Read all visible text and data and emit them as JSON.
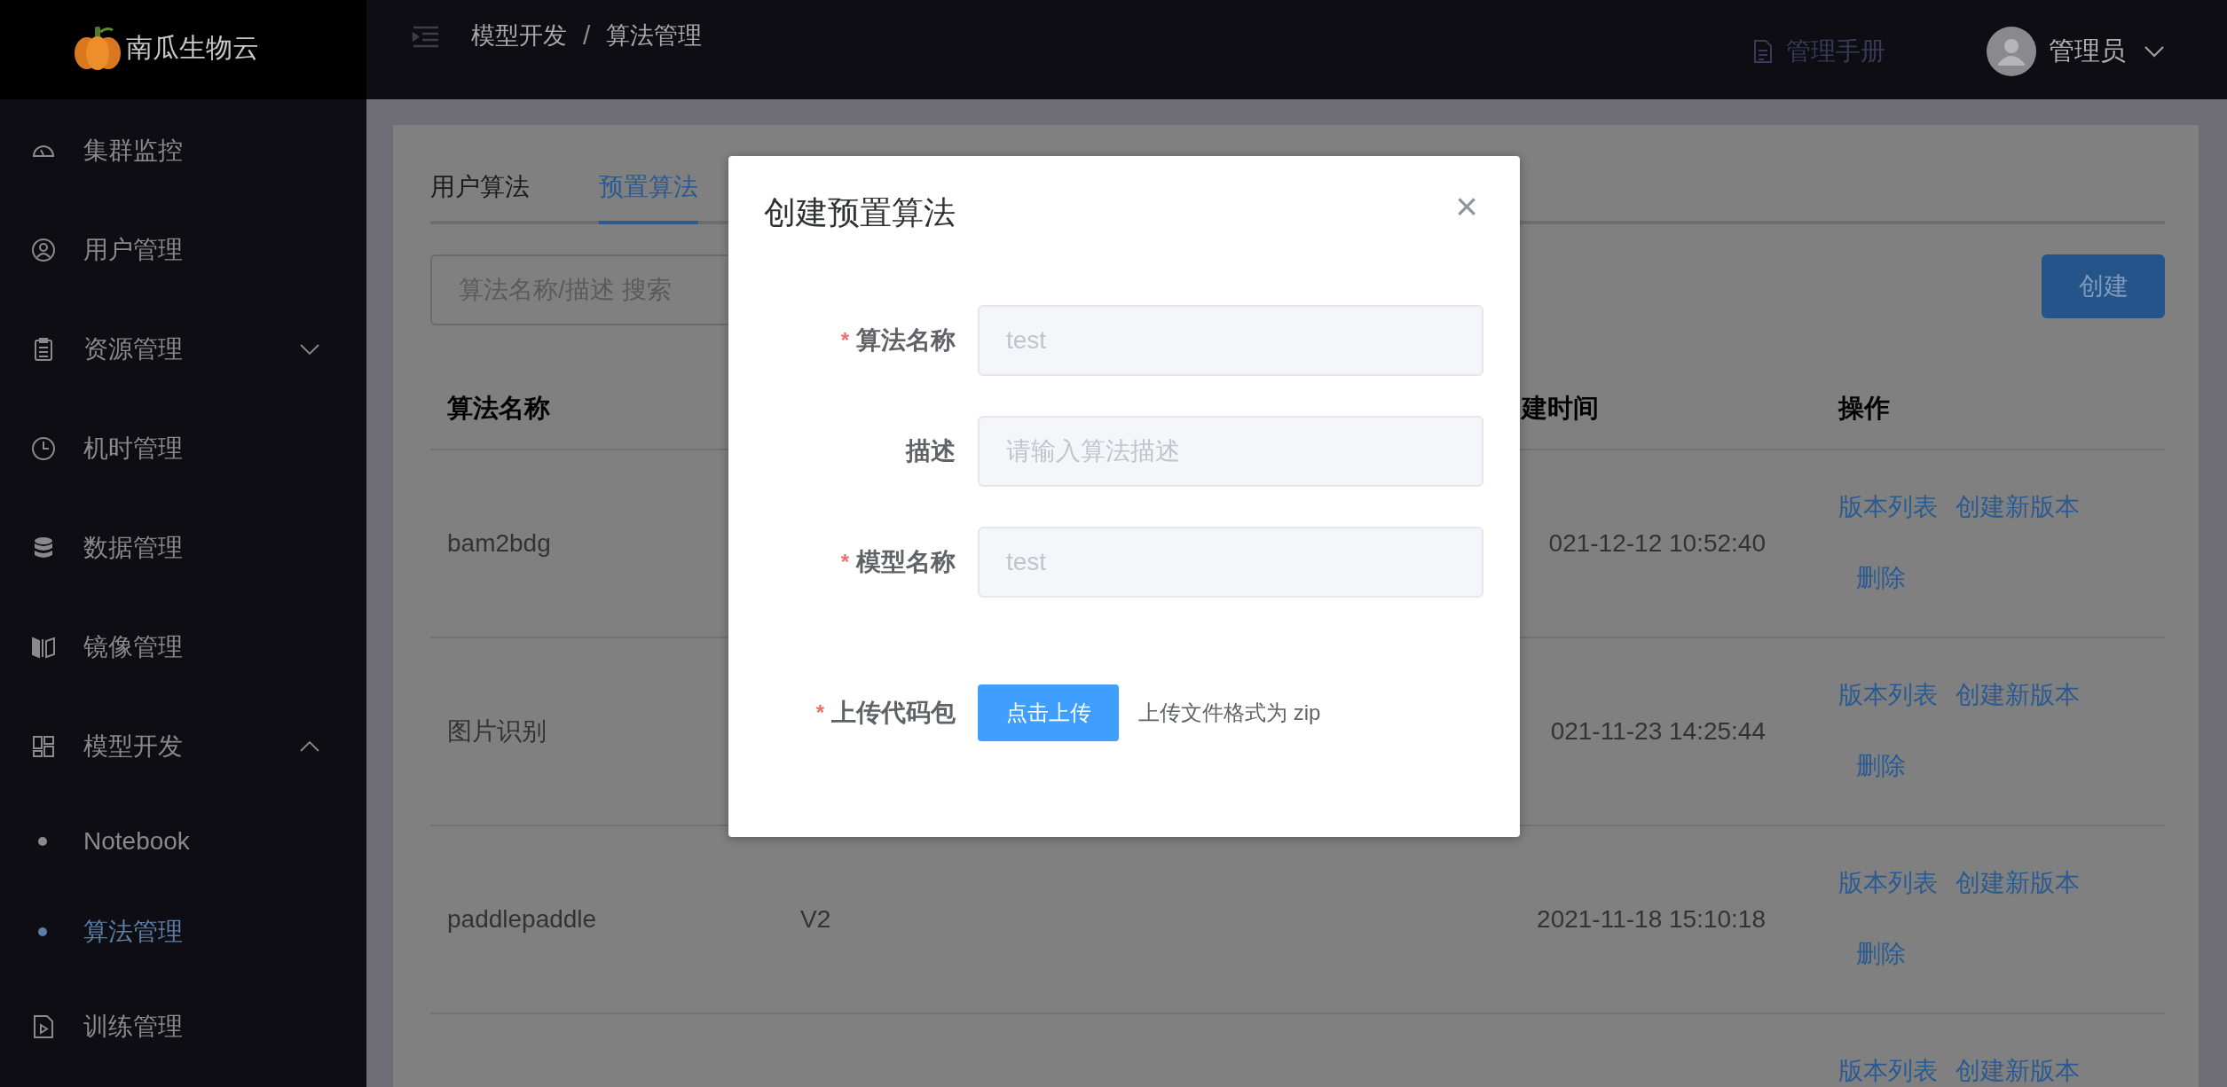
{
  "logo": {
    "text": "南瓜生物云"
  },
  "header": {
    "breadcrumb": [
      "模型开发",
      "算法管理"
    ],
    "separator": "/",
    "manual": "管理手册",
    "user": "管理员"
  },
  "sidebar": {
    "items": [
      {
        "label": "集群监控",
        "selected": false
      },
      {
        "label": "用户管理",
        "selected": false
      },
      {
        "label": "资源管理",
        "selected": false,
        "expanded": false
      },
      {
        "label": "机时管理",
        "selected": false
      },
      {
        "label": "数据管理",
        "selected": false
      },
      {
        "label": "镜像管理",
        "selected": false
      },
      {
        "label": "模型开发",
        "selected": false,
        "expanded": true,
        "children": [
          {
            "label": "Notebook",
            "selected": false
          },
          {
            "label": "算法管理",
            "selected": true
          }
        ]
      },
      {
        "label": "训练管理",
        "selected": false
      }
    ]
  },
  "tabs": [
    {
      "label": "用户算法",
      "selected": false
    },
    {
      "label": "预置算法",
      "selected": true
    }
  ],
  "search": {
    "placeholder": "算法名称/描述 搜索"
  },
  "create_button": "创建",
  "table": {
    "columns": {
      "name": "算法名称",
      "time": "建时间",
      "actions": "操作"
    },
    "rows": [
      {
        "name": "bam2bdg",
        "time": "021-12-12 10:52:40",
        "actions": [
          "版本列表",
          "创建新版本",
          "删除"
        ]
      },
      {
        "name": "图片识别",
        "time": "021-11-23 14:25:44",
        "actions": [
          "版本列表",
          "创建新版本",
          "删除"
        ]
      },
      {
        "name": "paddlepaddle",
        "version": "V2",
        "time": "2021-11-18 15:10:18",
        "actions": [
          "版本列表",
          "创建新版本",
          "删除"
        ]
      },
      {
        "actions": [
          "版本列表",
          "创建新版本"
        ]
      }
    ]
  },
  "dialog": {
    "title": "创建预置算法",
    "close": "×",
    "fields": [
      {
        "label": "算法名称",
        "required_mark": "*",
        "value": "test"
      },
      {
        "label": "描述",
        "placeholder": "请输入算法描述"
      },
      {
        "label": "模型名称",
        "required_mark": "*",
        "value": "test"
      }
    ],
    "upload": {
      "label": "上传代码包",
      "required_mark": "*",
      "button": "点击上传",
      "hint": "上传文件格式为 zip"
    }
  }
}
